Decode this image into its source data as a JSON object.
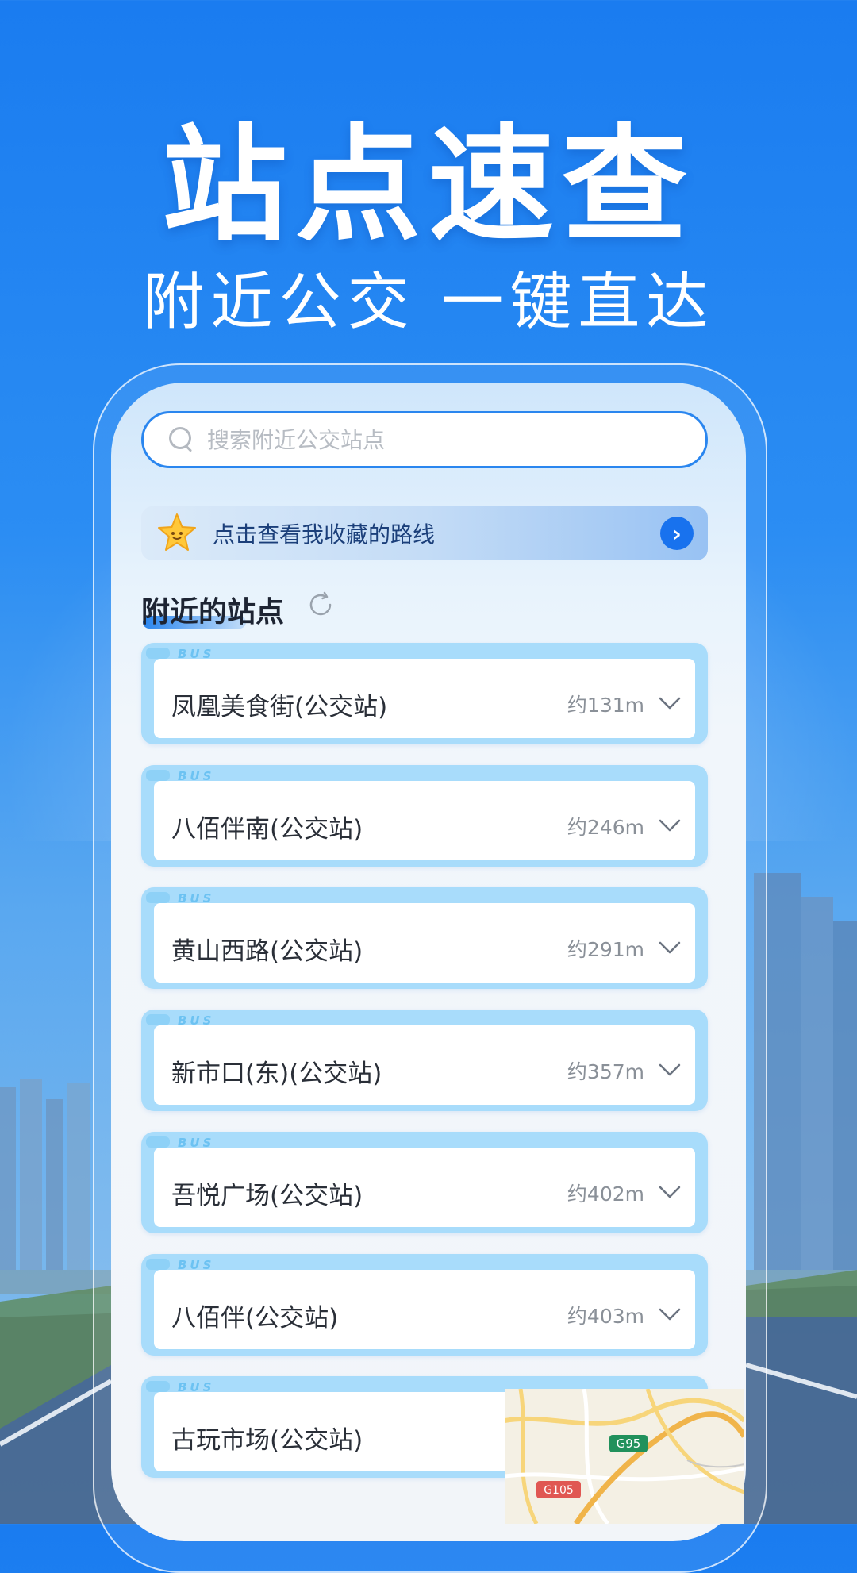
{
  "hero": {
    "title": "站点速查",
    "subtitle": "附近公交 一键直达"
  },
  "search": {
    "placeholder": "搜索附近公交站点"
  },
  "favorites_banner": {
    "text": "点击查看我收藏的路线",
    "arrow": "›"
  },
  "nearby": {
    "title": "附近的站点",
    "tag_label": "BUS",
    "stations": [
      {
        "name": "凤凰美食街(公交站)",
        "distance": "约131m"
      },
      {
        "name": "八佰伴南(公交站)",
        "distance": "约246m"
      },
      {
        "name": "黄山西路(公交站)",
        "distance": "约291m"
      },
      {
        "name": "新市口(东)(公交站)",
        "distance": "约357m"
      },
      {
        "name": "吾悦广场(公交站)",
        "distance": "约402m"
      },
      {
        "name": "八佰伴(公交站)",
        "distance": "约403m"
      },
      {
        "name": "古玩市场(公交站)",
        "distance": ""
      }
    ]
  },
  "map": {
    "road_labels": [
      "G95",
      "G105"
    ]
  },
  "colors": {
    "primary": "#1a7cf0",
    "card_tint": "#a8dcfb",
    "accent_arrow": "#1872ee"
  }
}
